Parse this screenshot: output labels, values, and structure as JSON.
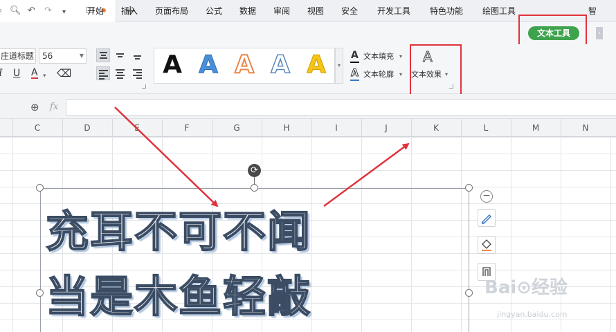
{
  "titlebar": {
    "new_tab_glyph": "+"
  },
  "menu": {
    "items": [
      "开始",
      "插入",
      "页面布局",
      "公式",
      "数据",
      "审阅",
      "视图",
      "安全",
      "开发工具",
      "特色功能",
      "绘图工具"
    ],
    "active": "文本工具",
    "overflow": "智"
  },
  "ribbon": {
    "font_name": "庄道标题",
    "font_size": "56",
    "format_buttons": [
      "I",
      "U",
      "A"
    ],
    "art_styles_glyph": "A",
    "art_style_colors": [
      "#111111",
      "#4a90d9",
      "#e8884a",
      "#ffffff",
      "#f5c518"
    ],
    "text_fill": "文本填充",
    "text_outline": "文本轮廓",
    "text_effect": "文本效果",
    "text_effect_glyph": "A"
  },
  "formula_bar": {
    "fx": "fx",
    "value": ""
  },
  "columns": [
    "C",
    "D",
    "E",
    "F",
    "G",
    "H",
    "I",
    "J",
    "K",
    "L",
    "M",
    "N"
  ],
  "wordart": {
    "line1": "充耳不可不闻",
    "line2": "当是木鱼轻敲"
  },
  "watermark": {
    "logo": "Bai⊙经验",
    "url": "jingyan.baidu.com"
  },
  "colors": {
    "accent_green": "#3fa34d",
    "highlight_red": "#e0323c"
  }
}
